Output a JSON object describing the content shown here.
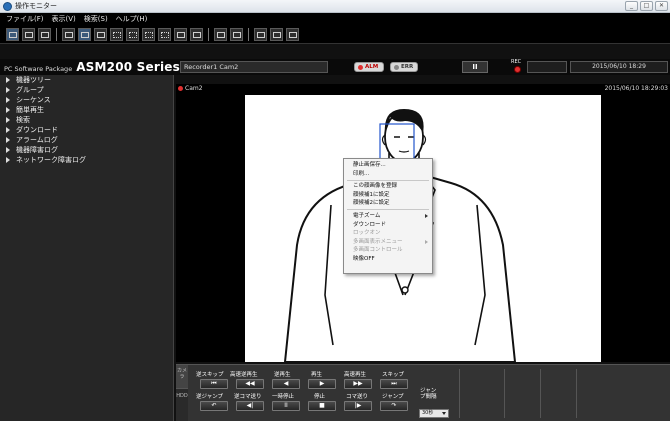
{
  "window": {
    "title": "操作モニター",
    "min_glyph": "_",
    "max_glyph": "□",
    "close_glyph": "✕"
  },
  "menubar": {
    "items": [
      "ファイル(F)",
      "表示(V)",
      "検索(S)",
      "ヘルプ(H)"
    ]
  },
  "toolbar": {
    "icons": [
      "camera-icon",
      "screenshot-icon",
      "record-icon",
      "layout-1-icon",
      "layout-4-icon",
      "layout-9-icon",
      "layout-16-icon",
      "layout-grid-icon",
      "alarm-icon",
      "settings-icon",
      "wrench-icon",
      "monitor-icon"
    ]
  },
  "header": {
    "package_label": "PC Software Package",
    "series_label": "ASM200 Series",
    "recorder_name": "Recorder1 Cam2",
    "alm_label": "ALM",
    "err_label": "ERR",
    "pause_glyph": "II",
    "rec_label": "REC",
    "datetime": "2015/06/10 18:29"
  },
  "tree": {
    "items": [
      "機器ツリー",
      "グループ",
      "シーケンス",
      "簡単再生",
      "検索",
      "ダウンロード",
      "アラームログ",
      "機器障害ログ",
      "ネットワーク障害ログ"
    ]
  },
  "camera_view": {
    "cam_label": "Cam2",
    "datetime": "2015/06/10 18:29:03"
  },
  "context_menu": {
    "items": [
      {
        "label": "静止画保存...",
        "enabled": true
      },
      {
        "label": "印刷...",
        "enabled": true
      },
      {
        "label": "この顔画像を登録",
        "enabled": true
      },
      {
        "label": "顔候補1に設定",
        "enabled": true
      },
      {
        "label": "顔候補2に設定",
        "enabled": true
      },
      {
        "label": "電子ズーム",
        "enabled": true
      },
      {
        "label": "ダウンロード",
        "enabled": true
      },
      {
        "label": "ロックオン",
        "enabled": false
      },
      {
        "label": "多画面表示メニュー",
        "enabled": false
      },
      {
        "label": "多画面コントロール",
        "enabled": false
      },
      {
        "label": "映像OFF",
        "enabled": true
      }
    ]
  },
  "playback": {
    "side_tab_camera": "カメラ",
    "side_tab_hdd": "HDD",
    "row1_labels": [
      "逆スキップ",
      "高速逆再生",
      "逆再生",
      "再生",
      "高速再生",
      "スキップ"
    ],
    "row1_glyphs": [
      "⏮",
      "◀◀",
      "◀",
      "▶",
      "▶▶",
      "⏭"
    ],
    "row2_labels": [
      "逆ジャンプ",
      "逆コマ送り",
      "一時停止",
      "停止",
      "コマ送り",
      "ジャンプ"
    ],
    "row2_glyphs": [
      "↶",
      "◀|",
      "II",
      "■",
      "|▶",
      "↷"
    ],
    "jump_interval_label": "ジャンプ間隔",
    "jump_interval_value": "30秒"
  }
}
